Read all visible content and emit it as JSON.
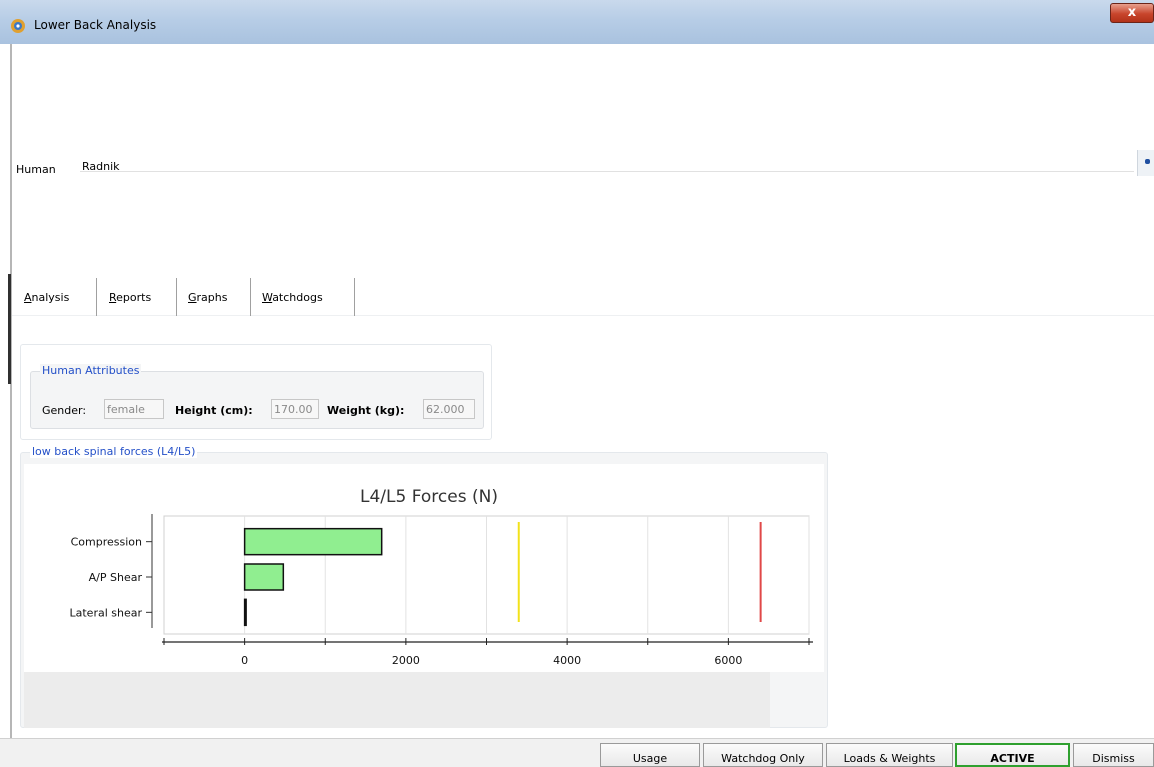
{
  "window": {
    "title": "Lower Back Analysis",
    "close_label": "x"
  },
  "human": {
    "label": "Human",
    "value": "Radnik"
  },
  "tabs": [
    {
      "mnemonic": "A",
      "rest": "nalysis"
    },
    {
      "mnemonic": "R",
      "rest": "eports"
    },
    {
      "mnemonic": "G",
      "rest": "raphs"
    },
    {
      "mnemonic": "W",
      "rest": "atchdogs"
    }
  ],
  "attributes": {
    "group_title": "Human Attributes",
    "gender_label": "Gender:",
    "gender_value": "female",
    "height_label": "Height (cm):",
    "height_value": "170.00",
    "weight_label": "Weight (kg):",
    "weight_value": "62.000"
  },
  "forces_group_title": "low back spinal forces (L4/L5)",
  "chart_data": {
    "type": "bar",
    "orientation": "horizontal",
    "title": "L4/L5 Forces (N)",
    "categories": [
      "Compression",
      "A/P Shear",
      "Lateral shear"
    ],
    "values": [
      1700,
      480,
      0
    ],
    "xlim": [
      -1000,
      7000
    ],
    "xticks": [
      0,
      2000,
      4000,
      6000
    ],
    "gridlines": [
      0,
      1000,
      2000,
      3000,
      4000,
      5000,
      6000,
      7000
    ],
    "thresholds": [
      {
        "value": 3400,
        "color": "#f2e21a"
      },
      {
        "value": 6400,
        "color": "#e04848"
      }
    ],
    "bar_color": "#90ee90",
    "grid": true
  },
  "status_buttons": {
    "usage": "Usage",
    "watchdog": "Watchdog Only",
    "loads": "Loads & Weights",
    "active": "ACTIVE",
    "dismiss": "Dismiss"
  },
  "colors": {
    "group_title": "#2450c8",
    "active_border": "#2fa02f"
  }
}
